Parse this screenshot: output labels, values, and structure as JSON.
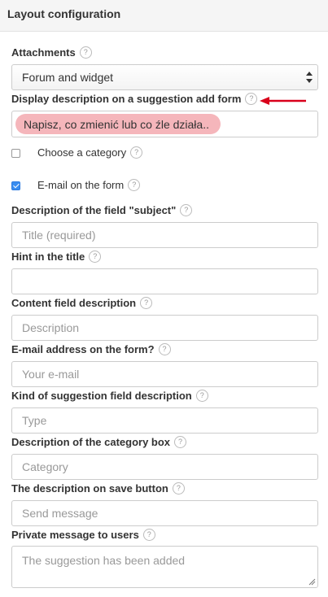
{
  "panel": {
    "title": "Layout configuration"
  },
  "help_glyph": "?",
  "attachments": {
    "label": "Attachments",
    "value": "Forum and widget"
  },
  "display_description": {
    "label": "Display description on a suggestion add form",
    "value": "Napisz, co zmienić lub co źle działa.."
  },
  "choose_category": {
    "label": "Choose a category",
    "checked": false
  },
  "email_on_form": {
    "label": "E-mail on the form",
    "checked": true
  },
  "subject_description": {
    "label": "Description of the field \"subject\"",
    "placeholder": "Title (required)"
  },
  "hint_title": {
    "label": "Hint in the title",
    "placeholder": ""
  },
  "content_description": {
    "label": "Content field description",
    "placeholder": "Description"
  },
  "email_address": {
    "label": "E-mail address on the form?",
    "placeholder": "Your e-mail"
  },
  "kind_description": {
    "label": "Kind of suggestion field description",
    "placeholder": "Type"
  },
  "category_box": {
    "label": "Description of the category box",
    "placeholder": "Category"
  },
  "save_button_description": {
    "label": "The description on save button",
    "placeholder": "Send message"
  },
  "private_message": {
    "label": "Private message to users",
    "placeholder": "The suggestion has been added"
  },
  "colors": {
    "highlight": "#f5b6bb",
    "arrow": "#d9001b",
    "checkbox": "#3b8ef0"
  }
}
